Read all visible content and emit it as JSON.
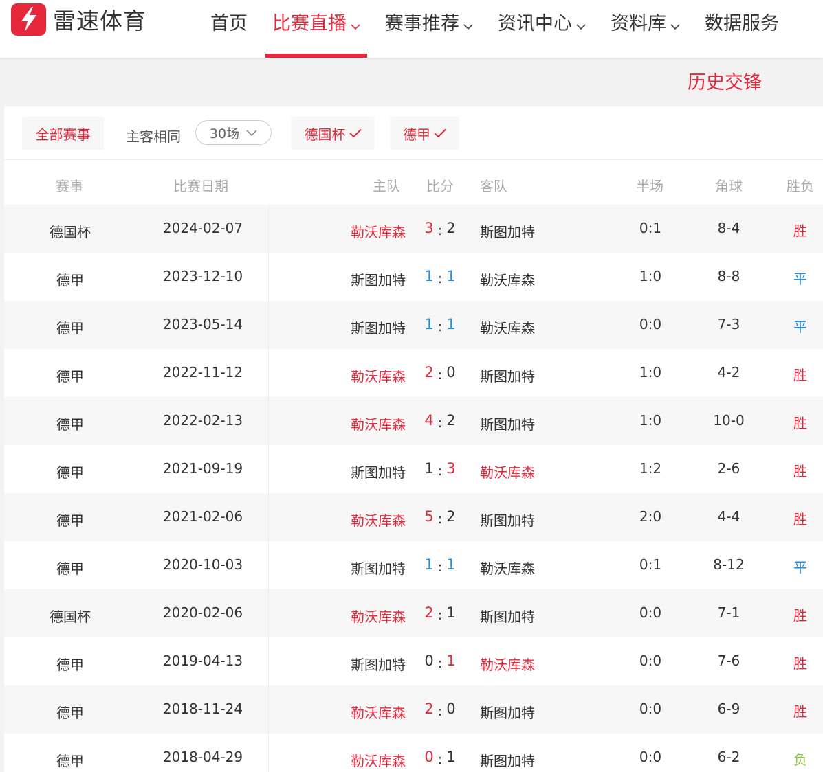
{
  "brand": {
    "name": "雷速体育",
    "color": "#e5283b"
  },
  "nav": [
    {
      "label": "首页",
      "active": false,
      "dropdown": false
    },
    {
      "label": "比赛直播",
      "active": true,
      "dropdown": true
    },
    {
      "label": "赛事推荐",
      "active": false,
      "dropdown": true
    },
    {
      "label": "资讯中心",
      "active": false,
      "dropdown": true
    },
    {
      "label": "资料库",
      "active": false,
      "dropdown": true
    },
    {
      "label": "数据服务",
      "active": false,
      "dropdown": false
    }
  ],
  "section_title": "历史交锋",
  "filters": {
    "all": "全部赛事",
    "same_label": "主客相同",
    "count_select": "30场",
    "cup": "德国杯",
    "league": "德甲"
  },
  "columns": {
    "competition": "赛事",
    "date": "比赛日期",
    "home": "主队",
    "score": "比分",
    "away": "客队",
    "half": "半场",
    "corners": "角球",
    "result": "胜负"
  },
  "colors": {
    "win": "#e5283b",
    "draw": "#1e8ce8",
    "loss": "#8cc63f"
  },
  "matches": [
    {
      "competition": "德国杯",
      "date": "2024-02-07",
      "home": "勒沃库森",
      "home_goals": "3",
      "away_goals": "2",
      "away": "斯图加特",
      "half": "0:1",
      "corners": "8-4",
      "result": "胜"
    },
    {
      "competition": "德甲",
      "date": "2023-12-10",
      "home": "斯图加特",
      "home_goals": "1",
      "away_goals": "1",
      "away": "勒沃库森",
      "half": "1:0",
      "corners": "8-8",
      "result": "平"
    },
    {
      "competition": "德甲",
      "date": "2023-05-14",
      "home": "斯图加特",
      "home_goals": "1",
      "away_goals": "1",
      "away": "勒沃库森",
      "half": "0:0",
      "corners": "7-3",
      "result": "平"
    },
    {
      "competition": "德甲",
      "date": "2022-11-12",
      "home": "勒沃库森",
      "home_goals": "2",
      "away_goals": "0",
      "away": "斯图加特",
      "half": "1:0",
      "corners": "4-2",
      "result": "胜"
    },
    {
      "competition": "德甲",
      "date": "2022-02-13",
      "home": "勒沃库森",
      "home_goals": "4",
      "away_goals": "2",
      "away": "斯图加特",
      "half": "1:0",
      "corners": "10-0",
      "result": "胜"
    },
    {
      "competition": "德甲",
      "date": "2021-09-19",
      "home": "斯图加特",
      "home_goals": "1",
      "away_goals": "3",
      "away": "勒沃库森",
      "half": "1:2",
      "corners": "2-6",
      "result": "胜"
    },
    {
      "competition": "德甲",
      "date": "2021-02-06",
      "home": "勒沃库森",
      "home_goals": "5",
      "away_goals": "2",
      "away": "斯图加特",
      "half": "2:0",
      "corners": "4-4",
      "result": "胜"
    },
    {
      "competition": "德甲",
      "date": "2020-10-03",
      "home": "斯图加特",
      "home_goals": "1",
      "away_goals": "1",
      "away": "勒沃库森",
      "half": "0:1",
      "corners": "8-12",
      "result": "平"
    },
    {
      "competition": "德国杯",
      "date": "2020-02-06",
      "home": "勒沃库森",
      "home_goals": "2",
      "away_goals": "1",
      "away": "斯图加特",
      "half": "0:0",
      "corners": "7-1",
      "result": "胜"
    },
    {
      "competition": "德甲",
      "date": "2019-04-13",
      "home": "斯图加特",
      "home_goals": "0",
      "away_goals": "1",
      "away": "勒沃库森",
      "half": "0:0",
      "corners": "7-6",
      "result": "胜"
    },
    {
      "competition": "德甲",
      "date": "2018-11-24",
      "home": "勒沃库森",
      "home_goals": "2",
      "away_goals": "0",
      "away": "斯图加特",
      "half": "0:0",
      "corners": "6-9",
      "result": "胜"
    },
    {
      "competition": "德甲",
      "date": "2018-04-29",
      "home": "勒沃库森",
      "home_goals": "0",
      "away_goals": "1",
      "away": "斯图加特",
      "half": "0:0",
      "corners": "6-2",
      "result": "负"
    }
  ]
}
